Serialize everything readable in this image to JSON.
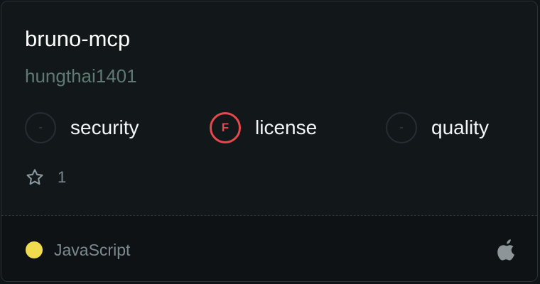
{
  "repo": {
    "name": "bruno-mcp",
    "owner": "hungthai1401"
  },
  "scores": [
    {
      "grade": "-",
      "label": "security",
      "status": "none"
    },
    {
      "grade": "F",
      "label": "license",
      "status": "fail"
    },
    {
      "grade": "-",
      "label": "quality",
      "status": "none"
    }
  ],
  "stars": {
    "count": "1",
    "icon": "star-outline-icon"
  },
  "footer": {
    "language": "JavaScript",
    "language_color": "#f0db4f",
    "platform_icon": "apple-icon"
  },
  "colors": {
    "fail": "#e5484d",
    "muted": "#7c8a8f",
    "author": "#5f7a72"
  }
}
